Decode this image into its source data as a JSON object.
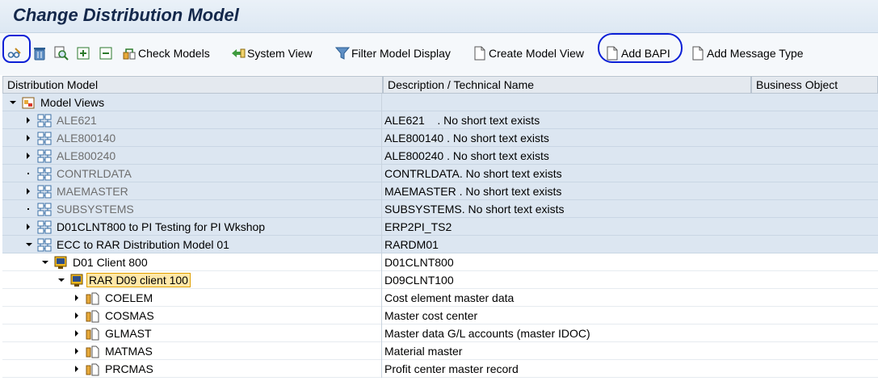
{
  "title": "Change Distribution Model",
  "toolbar": {
    "check_models": "Check Models",
    "system_view": "System View",
    "filter_model_display": "Filter Model Display",
    "create_model_view": "Create Model View",
    "add_bapi": "Add BAPI",
    "add_message_type": "Add Message Type"
  },
  "columns": {
    "distribution_model": "Distribution Model",
    "description": "Description / Technical Name",
    "business_object": "Business Object"
  },
  "rows": [
    {
      "name": "Model Views",
      "desc": ""
    },
    {
      "name": "ALE621",
      "desc": "ALE621    . No short text exists"
    },
    {
      "name": "ALE800140",
      "desc": "ALE800140 . No short text exists"
    },
    {
      "name": "ALE800240",
      "desc": "ALE800240 . No short text exists"
    },
    {
      "name": "CONTRLDATA",
      "desc": "CONTRLDATA. No short text exists"
    },
    {
      "name": "MAEMASTER",
      "desc": "MAEMASTER . No short text exists"
    },
    {
      "name": "SUBSYSTEMS",
      "desc": "SUBSYSTEMS. No short text exists"
    },
    {
      "name": "D01CLNT800 to PI Testing for PI Wkshop",
      "desc": "ERP2PI_TS2"
    },
    {
      "name": "ECC to RAR Distribution Model 01",
      "desc": "RARDM01"
    },
    {
      "name": "D01 Client 800",
      "desc": "D01CLNT800"
    },
    {
      "name": "RAR D09 client 100",
      "desc": "D09CLNT100"
    },
    {
      "name": "COELEM",
      "desc": "Cost element master data"
    },
    {
      "name": "COSMAS",
      "desc": "Master cost center"
    },
    {
      "name": "GLMAST",
      "desc": "Master data G/L accounts (master IDOC)"
    },
    {
      "name": "MATMAS",
      "desc": "Material master"
    },
    {
      "name": "PRCMAS",
      "desc": "Profit center master record"
    }
  ]
}
